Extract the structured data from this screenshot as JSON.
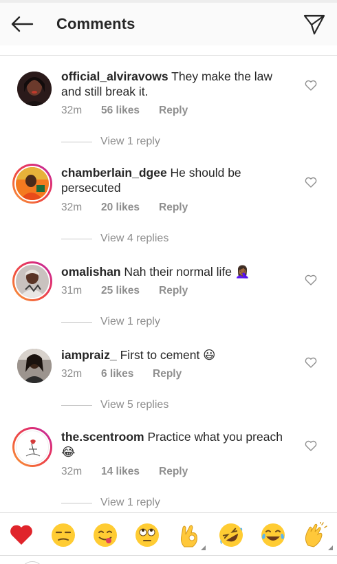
{
  "header": {
    "title": "Comments"
  },
  "comments": [
    {
      "username": "official_alviravows",
      "text": " They make the law and still break it.",
      "time": "32m",
      "likes": "56 likes",
      "reply": "Reply",
      "view_replies": "View 1 reply"
    },
    {
      "username": "chamberlain_dgee",
      "text": " He should be persecuted",
      "time": "32m",
      "likes": "20 likes",
      "reply": "Reply",
      "view_replies": "View 4 replies"
    },
    {
      "username": "omalishan",
      "text": " Nah their normal life 🤦🏾‍♀️",
      "time": "31m",
      "likes": "25 likes",
      "reply": "Reply",
      "view_replies": "View 1 reply"
    },
    {
      "username": "iampraiz_",
      "text": " First to cement 😃",
      "time": "32m",
      "likes": "6 likes",
      "reply": "Reply",
      "view_replies": "View 5 replies"
    },
    {
      "username": "the.scentroom",
      "text": " Practice what you preach 😂",
      "time": "32m",
      "likes": "14 likes",
      "reply": "Reply",
      "view_replies": "View 1 reply"
    }
  ],
  "emoji_bar": [
    "❤️",
    "😒",
    "😋",
    "🙄",
    "👌",
    "🤣",
    "😂",
    "👏"
  ],
  "colors": {
    "text": "#262626",
    "meta": "#8e8e8e",
    "ring_start": "#f9a23a",
    "ring_end": "#b52ab3"
  }
}
